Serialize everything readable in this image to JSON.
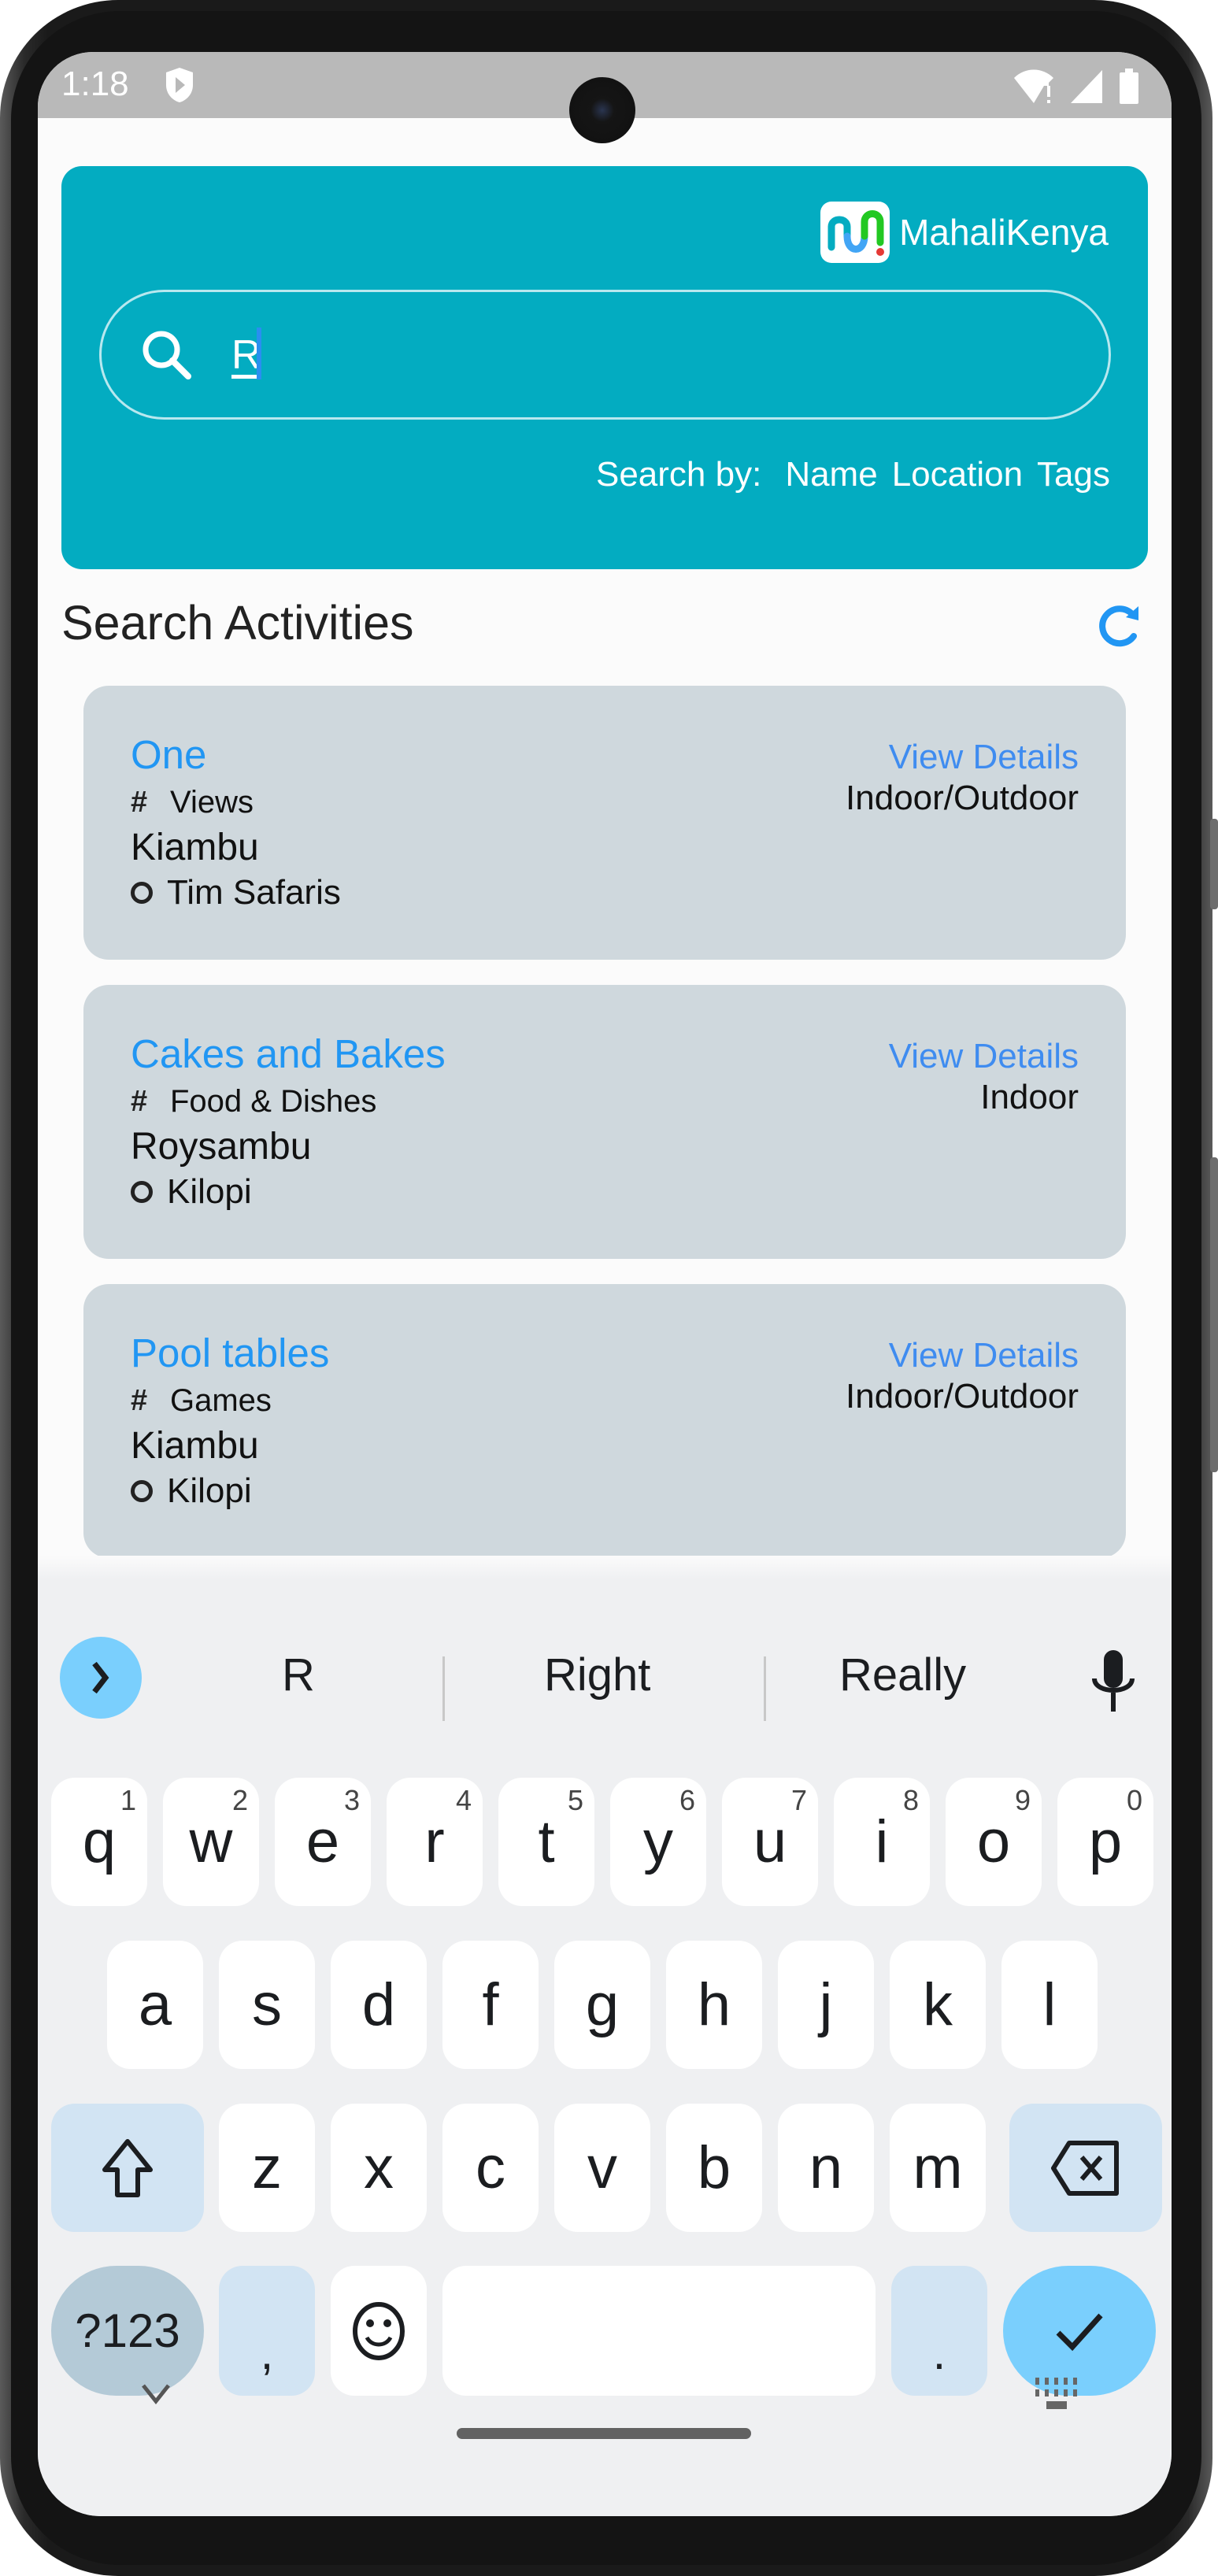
{
  "status_bar": {
    "time": "1:18",
    "icons": [
      "shield-play-icon",
      "wifi-alert-icon",
      "cellular-signal-icon",
      "battery-icon"
    ]
  },
  "header": {
    "brand_name": "MahaliKenya",
    "brand_colors": {
      "background": "#03acc1",
      "logo_blue": "#42a5f5",
      "logo_teal": "#03acc1",
      "logo_green": "#22c822",
      "logo_red": "#e53935"
    },
    "search": {
      "value": "R",
      "icon": "search-icon"
    },
    "search_by": {
      "label": "Search by:",
      "options": [
        "Name",
        "Location",
        "Tags"
      ]
    }
  },
  "section": {
    "title": "Search Activities",
    "refresh_icon": "refresh-icon"
  },
  "activities": [
    {
      "title": "One",
      "tag": "Views",
      "location": "Kiambu",
      "organizer": "Tim Safaris",
      "view_label": "View Details",
      "environment": "Indoor/Outdoor"
    },
    {
      "title": "Cakes and Bakes",
      "tag": "Food & Dishes",
      "location": "Roysambu",
      "organizer": "Kilopi",
      "view_label": "View Details",
      "environment": "Indoor"
    },
    {
      "title": "Pool tables",
      "tag": "Games",
      "location": "Kiambu",
      "organizer": "Kilopi",
      "view_label": "View Details",
      "environment": "Indoor/Outdoor"
    }
  ],
  "keyboard": {
    "suggestions": [
      "R",
      "Right",
      "Really"
    ],
    "row1": [
      {
        "k": "q",
        "h": "1"
      },
      {
        "k": "w",
        "h": "2"
      },
      {
        "k": "e",
        "h": "3"
      },
      {
        "k": "r",
        "h": "4"
      },
      {
        "k": "t",
        "h": "5"
      },
      {
        "k": "y",
        "h": "6"
      },
      {
        "k": "u",
        "h": "7"
      },
      {
        "k": "i",
        "h": "8"
      },
      {
        "k": "o",
        "h": "9"
      },
      {
        "k": "p",
        "h": "0"
      }
    ],
    "row2": [
      "a",
      "s",
      "d",
      "f",
      "g",
      "h",
      "j",
      "k",
      "l"
    ],
    "row3": [
      "z",
      "x",
      "c",
      "v",
      "b",
      "n",
      "m"
    ],
    "symbols_label": "?123",
    "comma": ",",
    "period": ".",
    "accent_color": "#7acffd"
  }
}
